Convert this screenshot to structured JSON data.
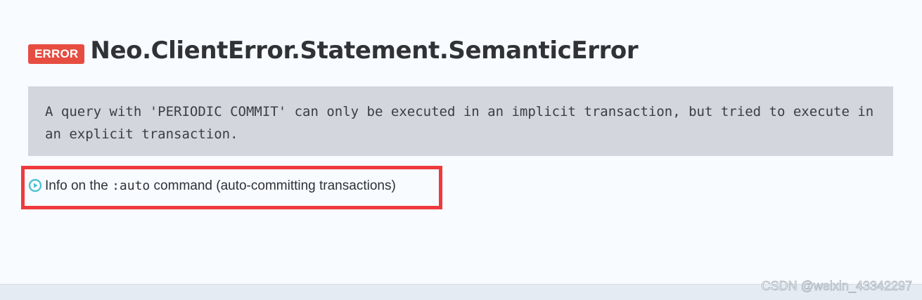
{
  "error": {
    "badge_label": "ERROR",
    "code": "Neo.ClientError.Statement.SemanticError",
    "message": "A query with 'PERIODIC COMMIT' can only be executed in an implicit transaction, but tried to execute in an explicit transaction."
  },
  "info_link": {
    "prefix": "Info on the ",
    "command": ":auto",
    "suffix": " command (auto-committing transactions)",
    "icon": "play-circle-icon"
  },
  "watermark": "CSDN @weixin_43342297",
  "colors": {
    "badge_bg": "#e64d40",
    "highlight_border": "#ee3a3d",
    "icon_accent": "#4fc1d6",
    "message_bg": "#d3d6dc",
    "page_bg": "#f8fbff"
  }
}
